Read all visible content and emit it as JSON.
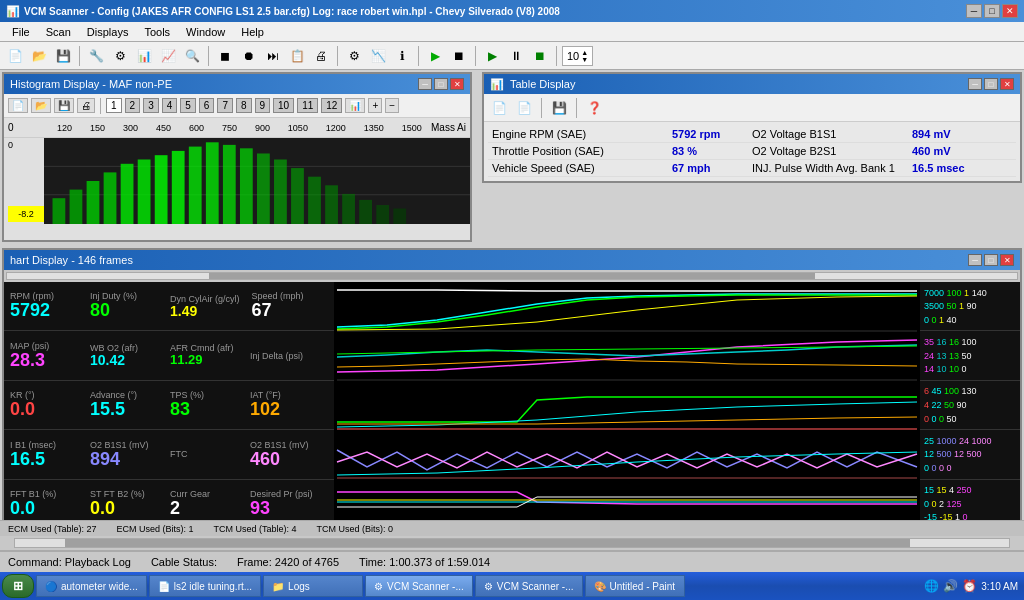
{
  "app": {
    "title": "VCM Scanner - Config (JAKES AFR CONFIG LS1 2.5 bar.cfg)  Log: race robert win.hpl  -  Chevy Silverado (V8) 2008",
    "icon": "vcm-icon"
  },
  "menu": {
    "items": [
      "File",
      "Scan",
      "Displays",
      "Tools",
      "Window",
      "Help"
    ]
  },
  "histogram": {
    "title": "Histogram Display  -  MAF non-PE",
    "tabs": [
      "1",
      "2",
      "3",
      "4",
      "5",
      "6",
      "7",
      "8",
      "9",
      "10",
      "11",
      "12"
    ],
    "mass_ai_label": "Mass Ai",
    "x_labels": [
      "0",
      "120",
      "150",
      "300",
      "450",
      "600",
      "750",
      "900",
      "1050",
      "1200",
      "1350",
      "1500"
    ],
    "y_top": "0",
    "y_bottom": "-8.2"
  },
  "table_display": {
    "title": "Table Display",
    "rows": [
      {
        "label": "Engine RPM (SAE)",
        "value": "5792 rpm",
        "label2": "O2 Voltage B1S1",
        "value2": "894 mV"
      },
      {
        "label": "Throttle Position (SAE)",
        "value": "83 %",
        "label2": "O2 Voltage B2S1",
        "value2": "460 mV"
      },
      {
        "label": "Vehicle Speed (SAE)",
        "value": "67 mph",
        "label2": "INJ. Pulse Width Avg. Bank 1",
        "value2": "16.5 msec"
      }
    ]
  },
  "chart": {
    "title": "hart Display  -  146 frames",
    "sections": [
      {
        "labels": [
          {
            "title": "RPM (rpm)",
            "value": "5792",
            "color": "cyan"
          },
          {
            "title": "Inj Duty (%)",
            "value": "80",
            "color": "green"
          },
          {
            "title": "Dyn CylAir (g/cyl)",
            "value": "1.49",
            "color": "yellow"
          },
          {
            "title": "Speed (mph)",
            "value": "67",
            "color": "white"
          }
        ],
        "right": "7000 100 1 140",
        "right2": "3500 50 1 90",
        "right3": "0 0 1 40"
      },
      {
        "labels": [
          {
            "title": "MAP (psi)",
            "value": "28.3",
            "color": "magenta"
          },
          {
            "title": "WB O2 (afr)",
            "value": "10.42",
            "color": "cyan"
          },
          {
            "title": "AFR Cmnd (afr)",
            "value": "11.29",
            "color": "green"
          },
          {
            "title": "Inj Delta (psi)",
            "value": "",
            "color": "white"
          }
        ],
        "right": "35 16 16 100",
        "right2": "24 13 13 50",
        "right3": "14 10 10 0"
      },
      {
        "labels": [
          {
            "title": "KR (°)",
            "value": "0.0",
            "color": "red"
          },
          {
            "title": "Advance (°)",
            "value": "15.5",
            "color": "cyan"
          },
          {
            "title": "TPS (%)",
            "value": "83",
            "color": "green"
          },
          {
            "title": "IAT (°F)",
            "value": "102",
            "color": "orange"
          }
        ],
        "right": "6 45 100 130",
        "right2": "4 22 50 90",
        "right3": "0 0 0 50"
      },
      {
        "labels": [
          {
            "title": "I B1 (msec)",
            "value": "16.5",
            "color": "cyan"
          },
          {
            "title": "O2 B1S1 (mV)",
            "value": "894",
            "color": "lightblue"
          },
          {
            "title": "FTC",
            "value": "",
            "color": "white"
          },
          {
            "title": "O2 B1S1 (mV)",
            "value": "460",
            "color": "pink"
          }
        ],
        "right": "25 1000 24 1000",
        "right2": "12 500 12 500",
        "right3": "0 0 0 0"
      },
      {
        "labels": [
          {
            "title": "FFT B1 (%)",
            "value": "0.0",
            "color": "cyan"
          },
          {
            "title": "ST FT B2 (%)",
            "value": "0.0",
            "color": "yellow"
          },
          {
            "title": "Curr Gear",
            "value": "2",
            "color": "white"
          },
          {
            "title": "Desired Pr (psi)",
            "value": "93",
            "color": "magenta"
          }
        ],
        "right": "15 15 4 250",
        "right2": "0 0 2 125",
        "right3": "-15 -15 1 0"
      }
    ]
  },
  "status_bar": {
    "command": "Command:  Playback Log",
    "cable": "Cable Status:",
    "frame": "Frame:  2420 of 4765",
    "time": "Time:  1:00.373 of 1:59.014"
  },
  "ecm_bar": {
    "items": [
      "ECM Used (Table): 27",
      "ECM Used (Bits): 1",
      "TCM Used (Table): 4",
      "TCM Used (Bits): 0"
    ]
  },
  "taskbar": {
    "time": "3:10 AM",
    "items": [
      {
        "label": "autometer wide...",
        "icon": "🔵"
      },
      {
        "label": "ls2 idle tuning.rt...",
        "icon": "📄"
      },
      {
        "label": "Logs",
        "icon": "📁"
      },
      {
        "label": "VCM Scanner -...",
        "icon": "⚙",
        "active": true
      },
      {
        "label": "VCM Scanner -...",
        "icon": "⚙",
        "active": false
      },
      {
        "label": "Untitled - Paint",
        "icon": "🎨"
      }
    ]
  }
}
